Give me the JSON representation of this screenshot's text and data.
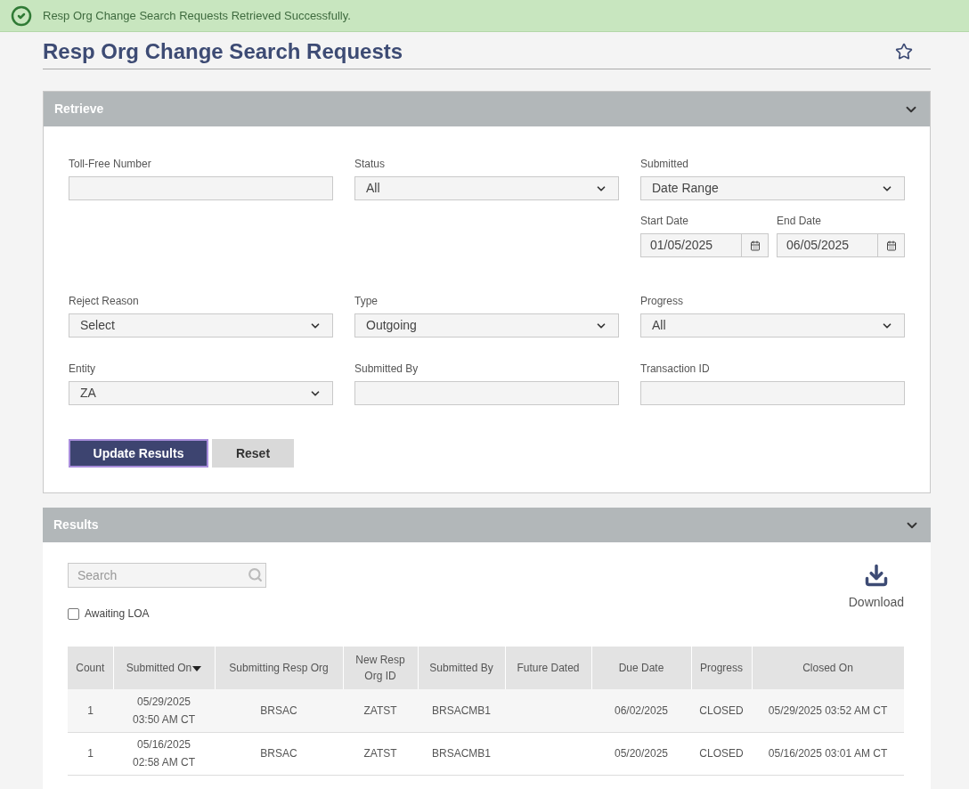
{
  "banner": {
    "message": "Resp Org Change Search Requests Retrieved Successfully."
  },
  "page": {
    "title": "Resp Org Change Search Requests",
    "favorite": false
  },
  "retrieve": {
    "title": "Retrieve",
    "expanded": true,
    "filters": [
      {
        "kind": "text",
        "label": "Toll-Free Number"
      },
      {
        "kind": "select",
        "label": "Status",
        "value": "All"
      },
      {
        "kind": "select",
        "label": "Submitted",
        "value": "Date Range"
      },
      {
        "kind": "select",
        "label": "Reject Reason",
        "value": "Select"
      },
      {
        "kind": "select",
        "label": "Type",
        "value": "Outgoing"
      },
      {
        "kind": "select",
        "label": "Progress",
        "value": "All"
      },
      {
        "kind": "select",
        "label": "Entity",
        "value": "ZA"
      },
      {
        "kind": "text",
        "label": "Submitted By"
      },
      {
        "kind": "text",
        "label": "Transaction ID"
      }
    ],
    "date_range": {
      "start_label": "Start Date",
      "start_value": "01/05/2025",
      "end_label": "End Date",
      "end_value": "06/05/2025"
    },
    "buttons": [
      {
        "label": "Update Results",
        "kind": "primary"
      },
      {
        "label": "Reset",
        "kind": "secondary"
      }
    ]
  },
  "results": {
    "title": "Results",
    "expanded": true,
    "search": {
      "placeholder": "Search"
    },
    "download": {
      "label": "Download"
    },
    "awaiting_loa": {
      "label": "Awaiting LOA",
      "checked": false
    },
    "columns": [
      {
        "label": "Count",
        "sorted": false
      },
      {
        "label": "Submitted On",
        "sorted": true
      },
      {
        "label": "Submitting Resp Org",
        "sorted": false
      },
      {
        "label": "New Resp Org ID",
        "sorted": false
      },
      {
        "label": "Submitted By",
        "sorted": false
      },
      {
        "label": "Future Dated",
        "sorted": false
      },
      {
        "label": "Due Date",
        "sorted": false
      },
      {
        "label": "Progress",
        "sorted": false
      },
      {
        "label": "Closed On",
        "sorted": false
      }
    ],
    "rows": [
      {
        "count": "1",
        "submitted_on": "05/29/2025 03:50 AM CT",
        "submitting_resp_org": "BRSAC",
        "new_resp_org_id": "ZATST",
        "submitted_by": "BRSACMB1",
        "due_date": "06/02/2025",
        "progress": "CLOSED",
        "closed_on": "05/29/2025 03:52 AM CT"
      },
      {
        "count": "1",
        "submitted_on": "05/16/2025 02:58 AM CT",
        "submitting_resp_org": "BRSAC",
        "new_resp_org_id": "ZATST",
        "submitted_by": "BRSACMB1",
        "due_date": "05/20/2025",
        "progress": "CLOSED",
        "closed_on": "05/16/2025 03:01 AM CT"
      }
    ]
  }
}
